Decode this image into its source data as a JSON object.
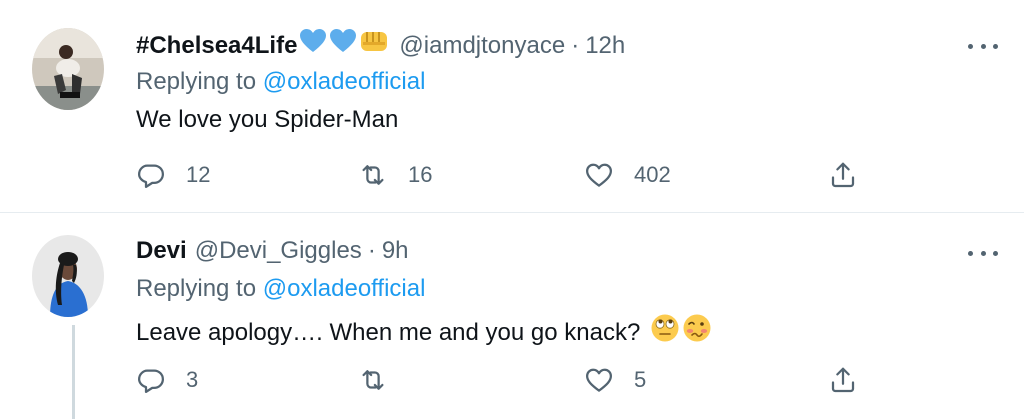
{
  "tweets": [
    {
      "name": "#Chelsea4Life",
      "name_emojis": [
        "blue-heart-emoji",
        "blue-heart-emoji",
        "oncoming-fist-emoji"
      ],
      "handle": "@iamdjtonyace",
      "separator": "·",
      "time": "12h",
      "replying_prefix": "Replying to",
      "replying_to": "@oxladeofficial",
      "text": "We love you Spider-Man",
      "text_emojis": [],
      "replies": "12",
      "retweets": "16",
      "likes": "402"
    },
    {
      "name": "Devi",
      "handle": "@Devi_Giggles",
      "separator": "·",
      "time": "9h",
      "replying_prefix": "Replying to",
      "replying_to": "@oxladeofficial",
      "text": "Leave apology…. When me and you go knack?",
      "text_emojis": [
        "face-with-rolling-eyes-emoji",
        "woozy-face-emoji"
      ],
      "replies": "3",
      "retweets": "",
      "likes": "5"
    }
  ],
  "colors": {
    "text": "#0f1419",
    "secondary": "#536471",
    "link": "#1d9bf0",
    "divider": "#e6ecf0",
    "thread_line": "#cfd9de"
  }
}
